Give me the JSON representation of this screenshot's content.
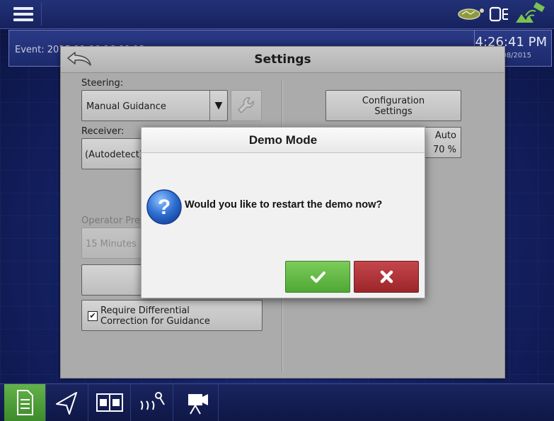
{
  "topbar": {
    "menu_icon": "hamburger-menu-icon",
    "status_icons": [
      "implement-icon",
      "display-status-icon",
      "gps-signal-icon"
    ]
  },
  "eventbar": {
    "event_text": "Event: 2015-11-10 16:09:13",
    "clock": "4:26:41 PM",
    "date": "11/08/2015"
  },
  "settings": {
    "title": "Settings",
    "steering_label": "Steering:",
    "steering_value": "Manual Guidance",
    "receiver_label": "Receiver:",
    "receiver_value": "(Autodetect)",
    "operator_label": "Operator Pres",
    "operator_value": "15 Minutes",
    "diff_checked": true,
    "diff_label_line1": "Require Differential",
    "diff_label_line2": "Correction for Guidance",
    "config_label_line1": "Configuration",
    "config_label_line2": "Settings",
    "auto_label": "Auto",
    "auto_pct": "70 %"
  },
  "modal": {
    "title": "Demo Mode",
    "message": "Would you like to restart the demo now?",
    "ok_icon": "checkmark-icon",
    "cancel_icon": "close-icon",
    "colors": {
      "ok": "#5cb33f",
      "cancel": "#b3343a"
    }
  },
  "bottom_nav": {
    "items": [
      "home-icon",
      "guidance-icon",
      "map-icon",
      "field-icon",
      "camera-icon"
    ],
    "active": "home-icon",
    "accent": "#4fa834"
  }
}
